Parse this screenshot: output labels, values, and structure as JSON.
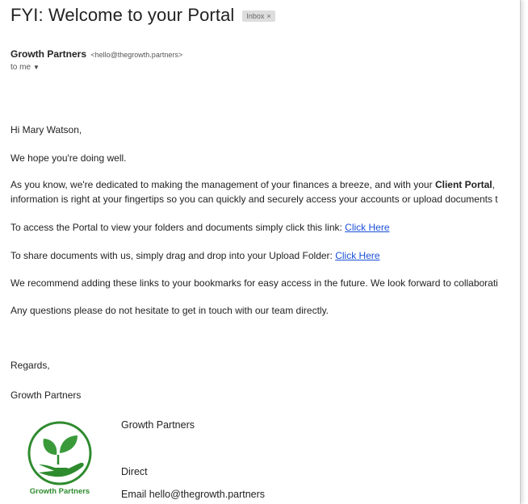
{
  "email": {
    "subject": "FYI: Welcome to your Portal",
    "label": "Inbox",
    "label_remove": "×",
    "sender": {
      "name": "Growth Partners",
      "email": "<hello@thegrowth.partners>"
    },
    "recipient": "to me",
    "body": {
      "greeting": "Hi Mary Watson,",
      "hope": "We hope you're doing well.",
      "intro_part1": "As you know, we're dedicated to making the management of your finances a breeze, and with your ",
      "intro_bold": "Client Portal",
      "intro_part2": ", ",
      "intro_line2": "information is right at your fingertips so you can quickly and securely access your accounts or upload documents t",
      "access_text": "To access the Portal to view your folders and documents simply click this link: ",
      "access_link": "Click Here",
      "share_text": "To share documents with us, simply drag and drop into your Upload Folder: ",
      "share_link": "Click Here",
      "bookmark": "We recommend adding these links to your bookmarks for easy access in the future. We look forward to collaborati",
      "questions": "Any questions please do not hesitate to get in touch with our team directly.",
      "regards": "Regards,",
      "signoff": "Growth Partners"
    },
    "signature": {
      "company": "Growth Partners",
      "direct": "Direct",
      "email_line": "Email hello@thegrowth.partners",
      "logo_text": "Growth Partners",
      "logo_icon": "hand-with-leaves-icon",
      "brand_color": "#2e8b2e"
    }
  }
}
